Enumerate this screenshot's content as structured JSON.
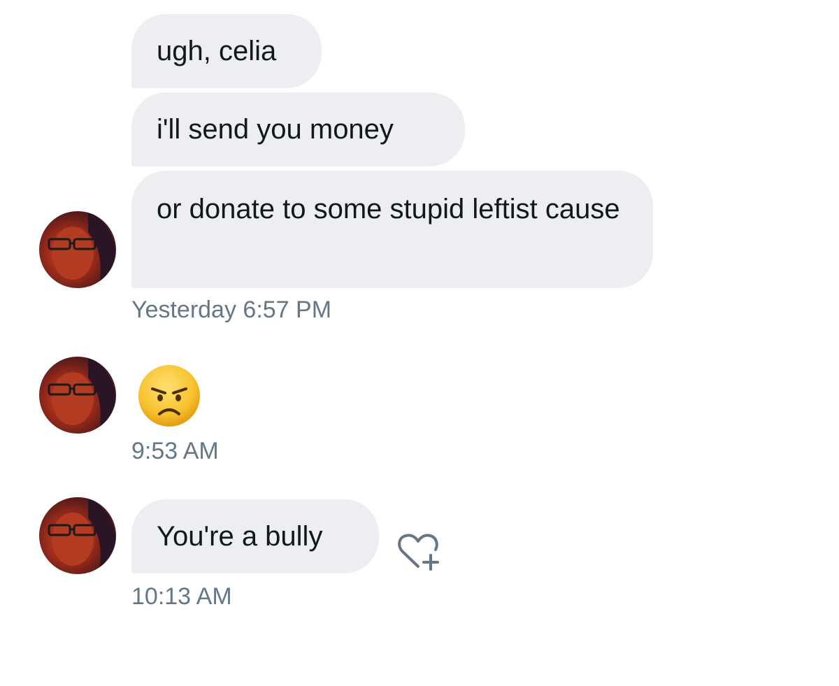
{
  "conversation": {
    "messages": [
      {
        "text": "ugh, celia"
      },
      {
        "text": "i'll send you money"
      },
      {
        "text": "or donate to some stupid leftist cause"
      },
      {
        "timestamp": "Yesterday 6:57 PM"
      },
      {
        "emoji": "angry-face"
      },
      {
        "timestamp": "9:53 AM"
      },
      {
        "text": "You're a bully"
      },
      {
        "timestamp": "10:13 AM"
      }
    ]
  },
  "icons": {
    "like": "heart-plus-icon",
    "emoji": "angry-face-emoji"
  },
  "colors": {
    "bubble": "#eceef1",
    "text": "#14171a",
    "timestamp": "#657786",
    "icon": "#657786"
  }
}
